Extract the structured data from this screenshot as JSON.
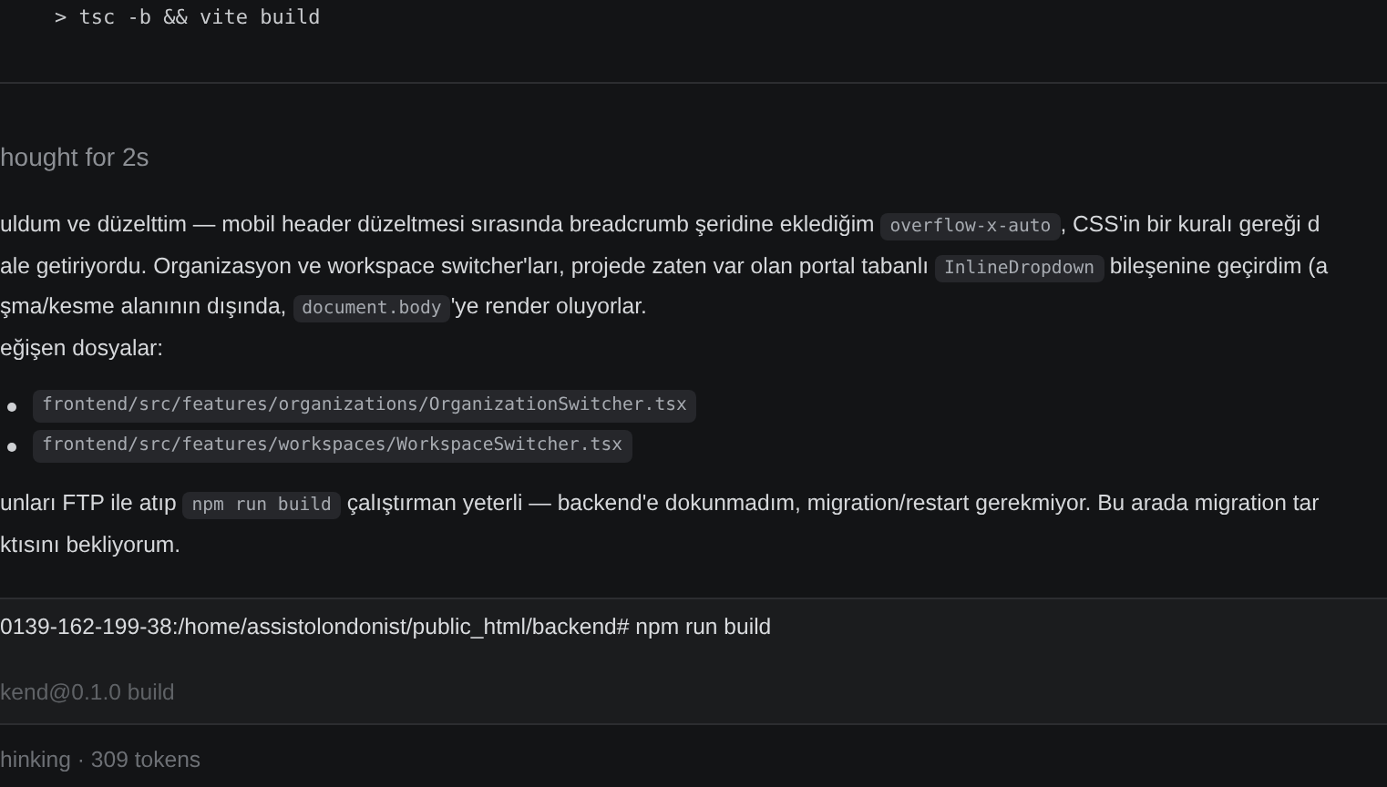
{
  "terminal_top": {
    "command": "> tsc -b && vite build"
  },
  "thought": {
    "label": "hought for 2s"
  },
  "blocks": [
    {
      "kind": "paragraph",
      "lines": [
        [
          {
            "text": "uldum ve düzelttim — mobil header düzeltmesi sırasında breadcrumb şeridine eklediğim ",
            "code": false
          },
          {
            "text": "overflow-x-auto",
            "code": true
          },
          {
            "text": ", CSS'in bir kuralı gereği d",
            "code": false
          }
        ],
        [
          {
            "text": "ale getiriyordu. Organizasyon ve workspace switcher'ları, projede zaten var olan portal tabanlı ",
            "code": false
          },
          {
            "text": "InlineDropdown",
            "code": true
          },
          {
            "text": " bileşenine geçirdim (a",
            "code": false
          }
        ],
        [
          {
            "text": "şma/kesme alanının dışında, ",
            "code": false
          },
          {
            "text": "document.body",
            "code": true
          },
          {
            "text": "'ye render oluyorlar.",
            "code": false
          }
        ],
        [
          {
            "text": "eğişen dosyalar:",
            "code": false
          }
        ]
      ]
    },
    {
      "kind": "list",
      "items": [
        [
          {
            "text": "frontend/src/features/organizations/OrganizationSwitcher.tsx",
            "code": true
          }
        ],
        [
          {
            "text": "frontend/src/features/workspaces/WorkspaceSwitcher.tsx",
            "code": true
          }
        ]
      ]
    },
    {
      "kind": "paragraph",
      "lines": [
        [
          {
            "text": "unları FTP ile atıp ",
            "code": false
          },
          {
            "text": "npm run build",
            "code": true
          },
          {
            "text": " çalıştırman yeterli — backend'e dokunmadım, migration/restart gerekmiyor. Bu arada migration tar",
            "code": false
          }
        ],
        [
          {
            "text": "ktısını bekliyorum.",
            "code": false
          }
        ]
      ]
    }
  ],
  "terminal": {
    "prompt": "0139-162-199-38:/home/assistolondonist/public_html/backend# npm run build",
    "output": "kend@0.1.0 build"
  },
  "footer": {
    "label": "hinking · 309 tokens"
  }
}
